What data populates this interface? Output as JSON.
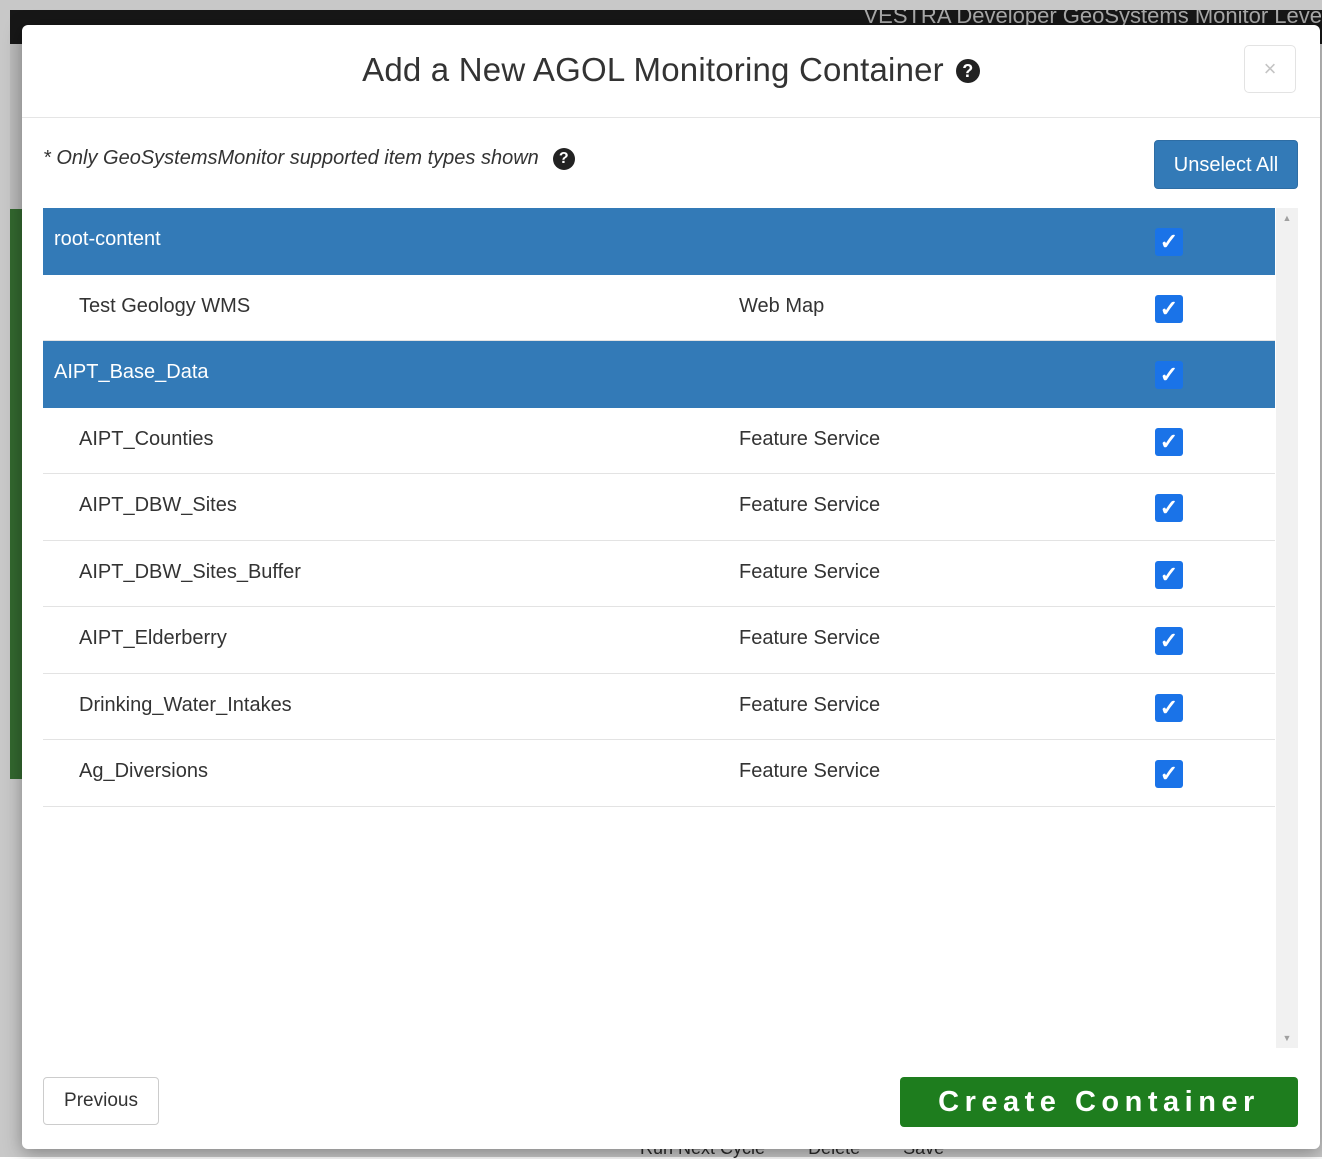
{
  "background_app": {
    "title": "VESTRA Developer GeoSystems Monitor Leve",
    "bottom_actions": [
      "Run Next Cycle",
      "Delete",
      "Save"
    ]
  },
  "modal": {
    "title": "Add a New AGOL Monitoring Container",
    "close_label": "×",
    "help_glyph": "?",
    "note": "* Only GeoSystemsMonitor supported item types shown",
    "unselect_all_label": "Unselect All",
    "rows": [
      {
        "kind": "folder",
        "name": "root-content",
        "type": "",
        "checked": true
      },
      {
        "kind": "item",
        "name": "Test Geology WMS",
        "type": "Web Map",
        "checked": true
      },
      {
        "kind": "folder",
        "name": "AIPT_Base_Data",
        "type": "",
        "checked": true
      },
      {
        "kind": "item",
        "name": "AIPT_Counties",
        "type": "Feature Service",
        "checked": true
      },
      {
        "kind": "item",
        "name": "AIPT_DBW_Sites",
        "type": "Feature Service",
        "checked": true
      },
      {
        "kind": "item",
        "name": "AIPT_DBW_Sites_Buffer",
        "type": "Feature Service",
        "checked": true
      },
      {
        "kind": "item",
        "name": "AIPT_Elderberry",
        "type": "Feature Service",
        "checked": true
      },
      {
        "kind": "item",
        "name": "Drinking_Water_Intakes",
        "type": "Feature Service",
        "checked": true
      },
      {
        "kind": "item",
        "name": "Ag_Diversions",
        "type": "Feature Service",
        "checked": true
      }
    ],
    "previous_label": "Previous",
    "create_label": "Create Container"
  },
  "colors": {
    "primary": "#337ab7",
    "success": "#1e7d1e",
    "checkbox": "#1a73e8"
  },
  "icons": {
    "checkbox_checked": "check-icon",
    "help": "question-circle-icon",
    "close": "close-icon",
    "scroll_up": "triangle-up-icon",
    "scroll_down": "triangle-down-icon"
  }
}
